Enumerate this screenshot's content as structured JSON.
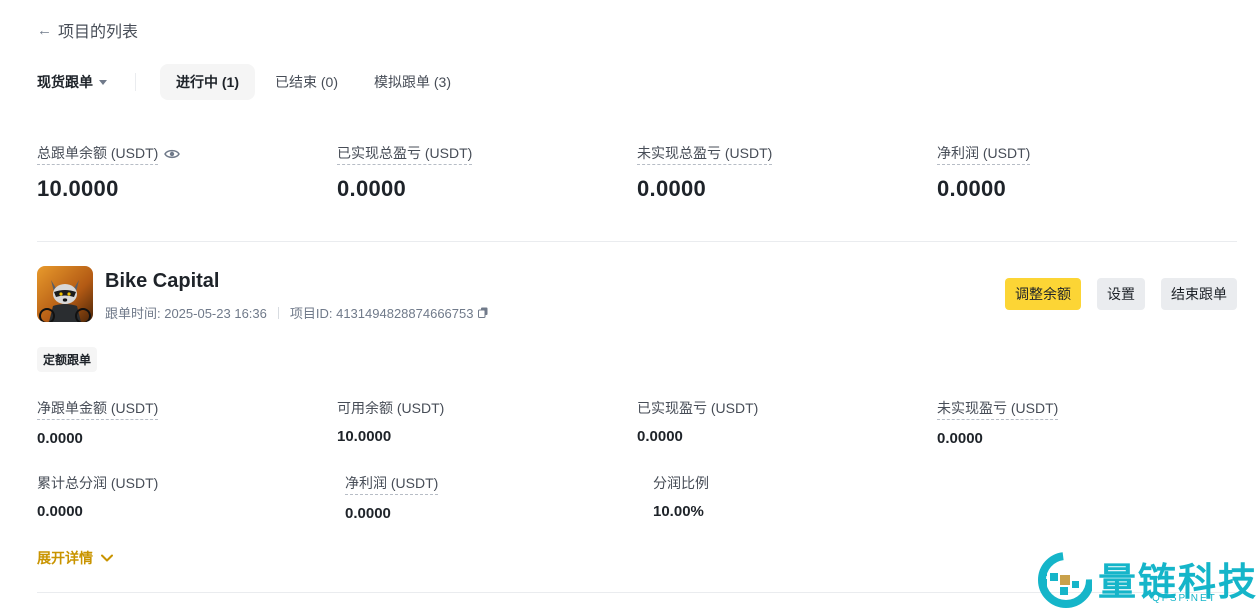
{
  "nav": {
    "back_label": "项目的列表"
  },
  "tabs_row": {
    "type_select": "现货跟单",
    "tabs": [
      {
        "label": "进行中 (1)",
        "active": true
      },
      {
        "label": "已结束 (0)",
        "active": false
      },
      {
        "label": "模拟跟单 (3)",
        "active": false
      }
    ]
  },
  "summary": [
    {
      "label": "总跟单余额 (USDT)",
      "value": "10.0000"
    },
    {
      "label": "已实现总盈亏 (USDT)",
      "value": "0.0000"
    },
    {
      "label": "未实现总盈亏 (USDT)",
      "value": "0.0000"
    },
    {
      "label": "净利润 (USDT)",
      "value": "0.0000"
    }
  ],
  "project": {
    "name": "Bike Capital",
    "time_label": "跟单时间: 2025-05-23 16:36",
    "id_label": "项目ID: 4131494828874666753",
    "badge": "定额跟单",
    "actions": {
      "adjust": "调整余额",
      "settings": "设置",
      "end": "结束跟单"
    }
  },
  "details_row1": [
    {
      "label": "净跟单金额 (USDT)",
      "value": "0.0000"
    },
    {
      "label": "可用余额 (USDT)",
      "value": "10.0000"
    },
    {
      "label": "已实现盈亏 (USDT)",
      "value": "0.0000"
    },
    {
      "label": "未实现盈亏 (USDT)",
      "value": "0.0000"
    }
  ],
  "details_row2": [
    {
      "label": "累计总分润 (USDT)",
      "value": "0.0000"
    },
    {
      "label": "净利润 (USDT)",
      "value": "0.0000"
    },
    {
      "label": "分润比例",
      "value": "10.00%"
    }
  ],
  "expand_label": "展开详情",
  "watermark": {
    "text": "量链科技",
    "sub": "QFSP.NET"
  },
  "colors": {
    "accent_yellow": "#fcd535",
    "link_gold": "#c99400",
    "watermark": "#15b5c9"
  }
}
